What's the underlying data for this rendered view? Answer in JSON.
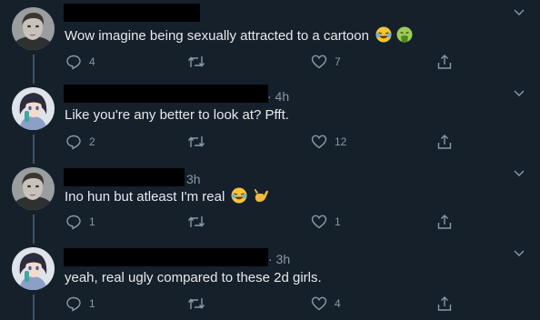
{
  "tweets": [
    {
      "time": "",
      "text": "Wow imagine being sexually attracted to a cartoon",
      "emojis": [
        "face-with-tears-of-joy",
        "face-vomiting"
      ],
      "replies": "4",
      "retweets": "",
      "likes": "7",
      "avatar": "photo-avatar"
    },
    {
      "time": "· 4h",
      "text": "Like you're any better to look at? Pfft.",
      "emojis": [],
      "replies": "2",
      "retweets": "",
      "likes": "12",
      "avatar": "anime-avatar"
    },
    {
      "time": "3h",
      "text": "Ino hun but atleast I'm real",
      "emojis": [
        "face-with-tears-of-joy",
        "call-me-hand"
      ],
      "replies": "1",
      "retweets": "",
      "likes": "1",
      "avatar": "photo-avatar"
    },
    {
      "time": "· 3h",
      "text": "yeah, real ugly compared to these 2d girls.",
      "emojis": [],
      "replies": "1",
      "retweets": "",
      "likes": "4",
      "avatar": "anime-avatar"
    }
  ],
  "colors": {
    "background": "#15202b",
    "text": "#e7e9ea",
    "muted": "#8899a6",
    "thread_line": "#3d5466"
  }
}
